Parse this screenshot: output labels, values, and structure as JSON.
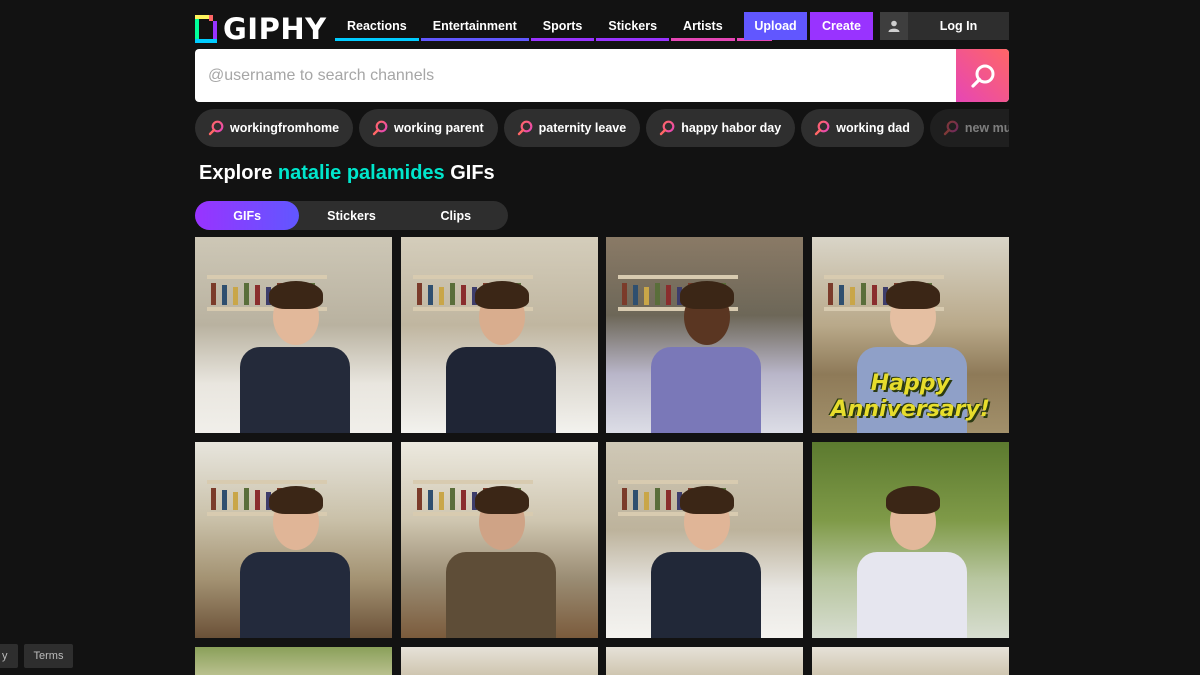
{
  "logo": {
    "text": "GIPHY"
  },
  "nav": [
    {
      "label": "Reactions",
      "color": "#00ccff"
    },
    {
      "label": "Entertainment",
      "color": "#6157ff"
    },
    {
      "label": "Sports",
      "color": "#9933ff"
    },
    {
      "label": "Stickers",
      "color": "#9933ff"
    },
    {
      "label": "Artists",
      "color": "#e646b6"
    },
    {
      "label": "⋮",
      "color": "#e646b6"
    }
  ],
  "header": {
    "upload": "Upload",
    "create": "Create",
    "login": "Log In"
  },
  "search": {
    "placeholder": "@username to search channels"
  },
  "trending": [
    "workingfromhome",
    "working parent",
    "paternity leave",
    "happy habor day",
    "working dad",
    "new mum"
  ],
  "heading": {
    "prefix": "Explore ",
    "highlight": "natalie palamides",
    "suffix": " GIFs"
  },
  "tabs": [
    {
      "label": "GIFs",
      "active": true
    },
    {
      "label": "Stickers",
      "active": false
    },
    {
      "label": "Clips",
      "active": false
    }
  ],
  "gifs": [
    {
      "overlay": ""
    },
    {
      "overlay": ""
    },
    {
      "overlay": ""
    },
    {
      "overlay": "Happy Anniversary!"
    },
    {
      "overlay": ""
    },
    {
      "overlay": ""
    },
    {
      "overlay": ""
    },
    {
      "overlay": ""
    }
  ],
  "footer": {
    "privacy_fragment": "y",
    "terms": "Terms"
  },
  "colors": {
    "accent_purple": "#9933ff",
    "accent_blue": "#6157ff",
    "highlight_teal": "#00e6cc",
    "search_pink": "#e646b6"
  }
}
